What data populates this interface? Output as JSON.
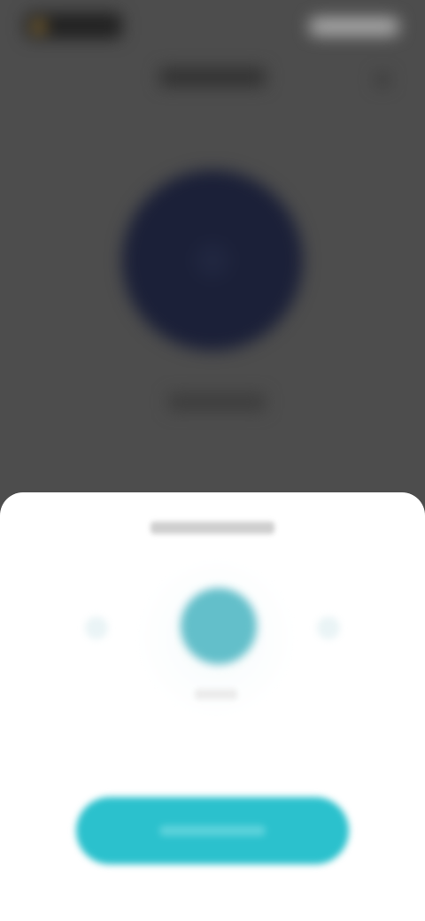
{
  "status_bar": {
    "left_icon": "camera-indicator-icon",
    "right_icons": "status-icons"
  },
  "header": {
    "title": "",
    "action_icon": "more-icon"
  },
  "hero": {
    "icon": "profile-circle-icon",
    "caption": ""
  },
  "sheet": {
    "title": "",
    "center_icon": "scan-target-icon",
    "center_caption": "",
    "primary_button_label": ""
  },
  "colors": {
    "backdrop": "#4d4d4d",
    "hero_circle": "#1b2038",
    "accent": "#2bc1cd",
    "target": "#63bfca",
    "sheet": "#ffffff"
  }
}
